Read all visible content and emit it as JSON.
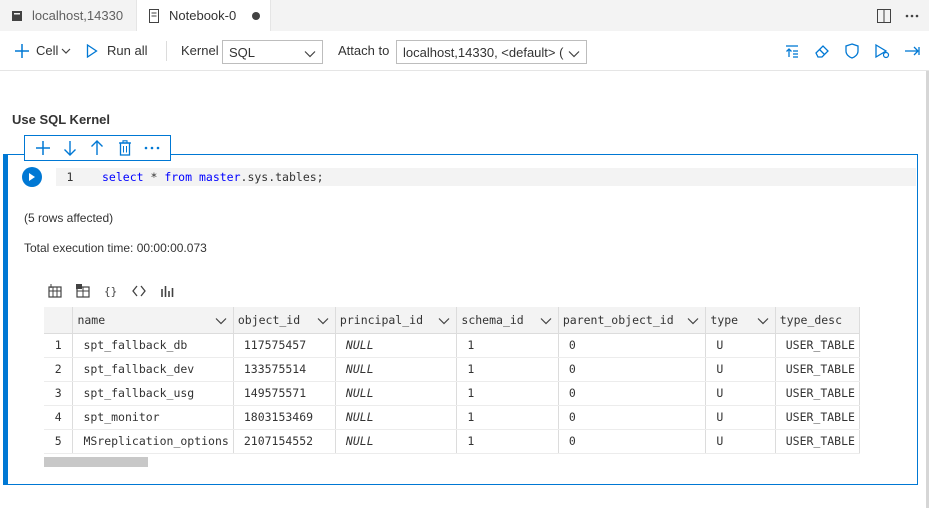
{
  "tabs": [
    {
      "label": "localhost,14330",
      "icon": "database-icon",
      "active": false
    },
    {
      "label": "Notebook-0",
      "icon": "notebook-icon",
      "active": true,
      "unsaved": true
    }
  ],
  "toolbar": {
    "cell_label": "Cell",
    "run_all_label": "Run all",
    "kernel_label": "Kernel",
    "kernel_value": "SQL",
    "attach_label": "Attach to",
    "attach_value": "localhost,14330, <default> ("
  },
  "markdown": {
    "heading": "Use SQL Kernel"
  },
  "code_cell": {
    "line_number": "1",
    "tokens": {
      "select": "select",
      "star": " * ",
      "from": "from",
      "space": " ",
      "object": "master",
      "rest": ".sys.tables;"
    }
  },
  "output": {
    "rows_affected": "(5 rows affected)",
    "execution_time": "Total execution time: 00:00:00.073"
  },
  "grid": {
    "columns": [
      "name",
      "object_id",
      "principal_id",
      "schema_id",
      "parent_object_id",
      "type",
      "type_desc"
    ],
    "rows": [
      {
        "n": "1",
        "name": "spt_fallback_db",
        "object_id": "117575457",
        "principal_id": "NULL",
        "schema_id": "1",
        "parent_object_id": "0",
        "type": "U",
        "type_desc": "USER_TABLE"
      },
      {
        "n": "2",
        "name": "spt_fallback_dev",
        "object_id": "133575514",
        "principal_id": "NULL",
        "schema_id": "1",
        "parent_object_id": "0",
        "type": "U",
        "type_desc": "USER_TABLE"
      },
      {
        "n": "3",
        "name": "spt_fallback_usg",
        "object_id": "149575571",
        "principal_id": "NULL",
        "schema_id": "1",
        "parent_object_id": "0",
        "type": "U",
        "type_desc": "USER_TABLE"
      },
      {
        "n": "4",
        "name": "spt_monitor",
        "object_id": "1803153469",
        "principal_id": "NULL",
        "schema_id": "1",
        "parent_object_id": "0",
        "type": "U",
        "type_desc": "USER_TABLE"
      },
      {
        "n": "5",
        "name": "MSreplication_options",
        "object_id": "2107154552",
        "principal_id": "NULL",
        "schema_id": "1",
        "parent_object_id": "0",
        "type": "U",
        "type_desc": "USER_TABLE"
      }
    ]
  },
  "colors": {
    "accent": "#0078d4",
    "keyword": "#0000ff"
  }
}
